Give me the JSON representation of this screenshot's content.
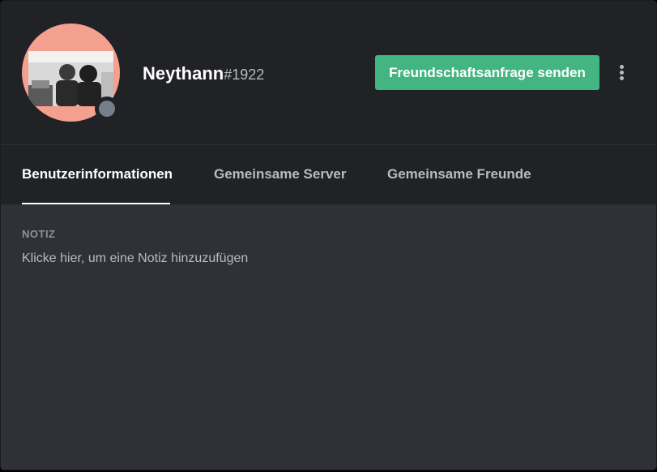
{
  "profile": {
    "username": "Neythann",
    "discriminator": "#1922",
    "status": "offline",
    "status_color": "#747f8d",
    "avatar_ring_color": "#f4a08f"
  },
  "actions": {
    "friend_request_label": "Freundschaftsanfrage senden",
    "friend_request_color": "#43b581",
    "more_icon": "vertical-ellipsis-icon"
  },
  "tabs": [
    {
      "label": "Benutzerinformationen",
      "active": true
    },
    {
      "label": "Gemeinsame Server",
      "active": false
    },
    {
      "label": "Gemeinsame Freunde",
      "active": false
    }
  ],
  "note": {
    "title": "NOTIZ",
    "placeholder": "Klicke hier, um eine Notiz hinzuzufügen"
  }
}
